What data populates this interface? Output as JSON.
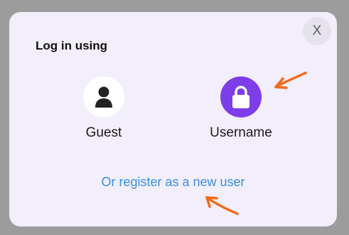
{
  "dialog": {
    "title": "Log in using",
    "close_label": "X",
    "options": [
      {
        "label": "Guest",
        "icon": "user-icon"
      },
      {
        "label": "Username",
        "icon": "lock-icon"
      }
    ],
    "register_link": "Or register as a new user"
  },
  "colors": {
    "overlay": "#9c9c9c",
    "dialog_bg": "#f3eefb",
    "accent_purple": "#7d3de8",
    "link_blue": "#3a8fe0",
    "annotation_arrow": "#f26a1b"
  }
}
